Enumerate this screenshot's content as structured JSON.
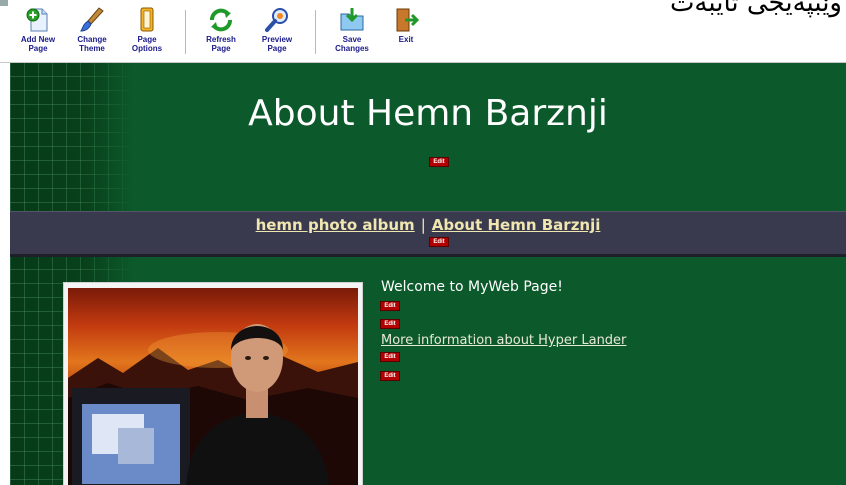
{
  "window_title_partial": "وێبپەیجی تایبەت",
  "toolbar": {
    "buttons": [
      {
        "id": "add-new-page",
        "label": "Add New\nPage"
      },
      {
        "id": "change-theme",
        "label": "Change\nTheme"
      },
      {
        "id": "page-options",
        "label": "Page\nOptions"
      },
      {
        "id": "refresh-page",
        "label": "Refresh\nPage"
      },
      {
        "id": "preview-page",
        "label": "Preview\nPage"
      },
      {
        "id": "save-changes",
        "label": "Save\nChanges"
      },
      {
        "id": "exit",
        "label": "Exit"
      }
    ]
  },
  "header": {
    "title": "About Hemn Barznji",
    "edit_label": "Edit"
  },
  "nav": {
    "links": [
      "hemn photo album",
      "About Hemn Barznji"
    ],
    "separator": "|",
    "edit_label": "Edit"
  },
  "content": {
    "welcome_text": "Welcome to MyWeb Page!",
    "more_info_link": "More information about Hyper Lander",
    "edit_label": "Edit"
  },
  "colors": {
    "page_green": "#0c5a2b",
    "nav_bar": "#3a3a4e",
    "nav_link": "#f0e6b0",
    "edit_red": "#b20000",
    "toolbar_label": "#1a1a8a"
  }
}
